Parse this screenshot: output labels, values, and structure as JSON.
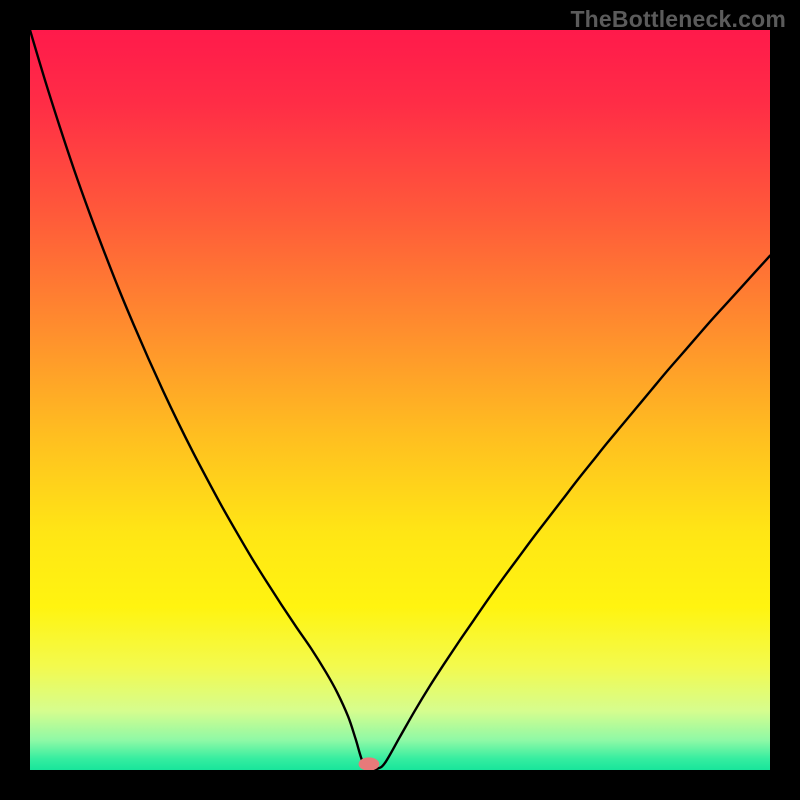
{
  "watermark": "TheBottleneck.com",
  "chart_data": {
    "type": "line",
    "title": "",
    "xlabel": "",
    "ylabel": "",
    "xlim": [
      0,
      100
    ],
    "ylim": [
      0,
      100
    ],
    "gradient_stops": [
      {
        "offset": 0.0,
        "color": "#ff1a4b"
      },
      {
        "offset": 0.1,
        "color": "#ff2d46"
      },
      {
        "offset": 0.25,
        "color": "#ff5a3a"
      },
      {
        "offset": 0.4,
        "color": "#ff8c2e"
      },
      {
        "offset": 0.55,
        "color": "#ffbf20"
      },
      {
        "offset": 0.68,
        "color": "#ffe615"
      },
      {
        "offset": 0.78,
        "color": "#fff410"
      },
      {
        "offset": 0.86,
        "color": "#f3fa4e"
      },
      {
        "offset": 0.92,
        "color": "#d6fd8e"
      },
      {
        "offset": 0.96,
        "color": "#8ef9a6"
      },
      {
        "offset": 0.985,
        "color": "#35eda0"
      },
      {
        "offset": 1.0,
        "color": "#18e59b"
      }
    ],
    "series": [
      {
        "name": "bottleneck-curve",
        "x": [
          0.0,
          2.0,
          4.0,
          6.0,
          8.0,
          10.0,
          12.0,
          14.0,
          16.0,
          18.0,
          20.0,
          22.0,
          24.0,
          26.0,
          28.0,
          30.0,
          32.0,
          34.0,
          36.0,
          38.0,
          40.0,
          41.5,
          43.0,
          44.0,
          45.0,
          46.0,
          47.0,
          48.0,
          50.0,
          52.0,
          54.0,
          56.0,
          58.0,
          60.0,
          62.0,
          64.0,
          66.0,
          68.0,
          70.0,
          72.0,
          74.0,
          76.0,
          78.0,
          80.0,
          82.0,
          84.0,
          86.0,
          88.0,
          90.0,
          92.0,
          94.0,
          96.0,
          98.0,
          100.0
        ],
        "y": [
          100.0,
          93.3,
          87.0,
          81.0,
          75.4,
          70.1,
          65.0,
          60.2,
          55.6,
          51.2,
          47.0,
          43.0,
          39.2,
          35.5,
          32.0,
          28.6,
          25.4,
          22.3,
          19.3,
          16.4,
          13.2,
          10.5,
          7.2,
          4.2,
          1.0,
          0.2,
          0.2,
          1.0,
          4.5,
          8.0,
          11.3,
          14.4,
          17.4,
          20.3,
          23.2,
          26.0,
          28.7,
          31.4,
          34.0,
          36.6,
          39.2,
          41.7,
          44.2,
          46.6,
          49.0,
          51.4,
          53.8,
          56.1,
          58.4,
          60.7,
          62.9,
          65.1,
          67.3,
          69.5
        ]
      }
    ],
    "marker": {
      "name": "optimal-point",
      "x": 45.8,
      "y": 0.8,
      "color": "#e77a7a",
      "rx": 1.4,
      "ry": 0.9
    }
  }
}
